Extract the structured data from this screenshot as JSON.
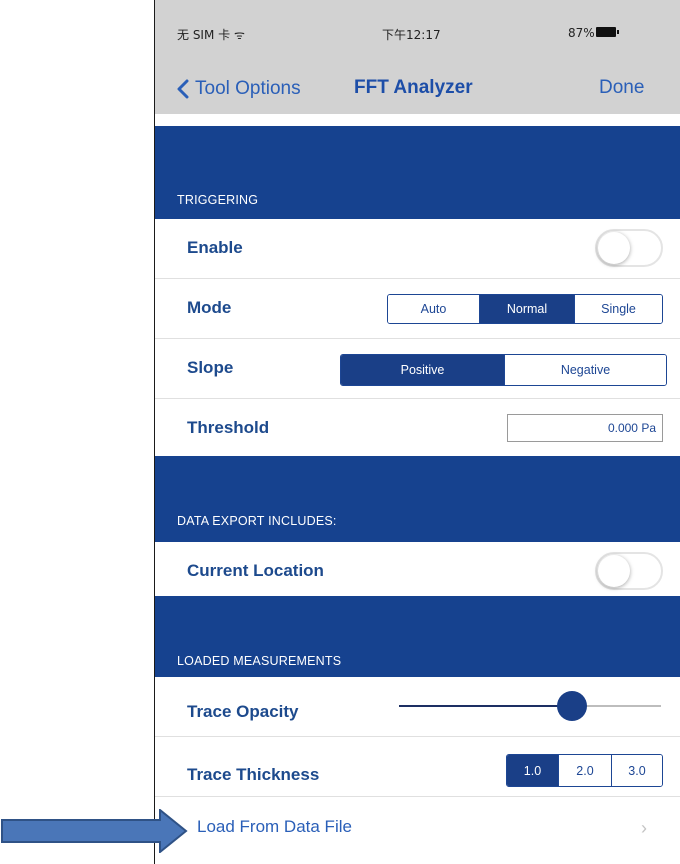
{
  "status_bar": {
    "carrier": "无 SIM 卡 ᯤ",
    "time": "下午12:17",
    "battery": "87%"
  },
  "nav": {
    "back_label": "Tool Options",
    "title": "FFT Analyzer",
    "done_label": "Done"
  },
  "sections": {
    "triggering": "TRIGGERING",
    "data_export": "DATA EXPORT INCLUDES:",
    "loaded_measurements": "LOADED MEASUREMENTS"
  },
  "triggering": {
    "enable": {
      "label": "Enable",
      "on": false
    },
    "mode": {
      "label": "Mode",
      "options": [
        "Auto",
        "Normal",
        "Single"
      ],
      "selected": "Normal"
    },
    "slope": {
      "label": "Slope",
      "options": [
        "Positive",
        "Negative"
      ],
      "selected": "Positive"
    },
    "threshold": {
      "label": "Threshold",
      "value": "0.000 Pa"
    }
  },
  "data_export": {
    "current_location": {
      "label": "Current Location",
      "on": false
    }
  },
  "loaded": {
    "trace_opacity": {
      "label": "Trace Opacity",
      "value": 0.66
    },
    "trace_thickness": {
      "label": "Trace Thickness",
      "options": [
        "1.0",
        "2.0",
        "3.0"
      ],
      "selected": "1.0"
    },
    "load_from_file": {
      "label": "Load From Data File"
    }
  },
  "colors": {
    "section_bg": "#16428f",
    "nav_bg": "#d2d2d2",
    "accent": "#1a3f87",
    "arrow": "#4a76b8"
  },
  "icons": {
    "back": "chevron-left-icon",
    "disclosure": "chevron-right-icon",
    "annotation": "right-arrow-annotation"
  }
}
